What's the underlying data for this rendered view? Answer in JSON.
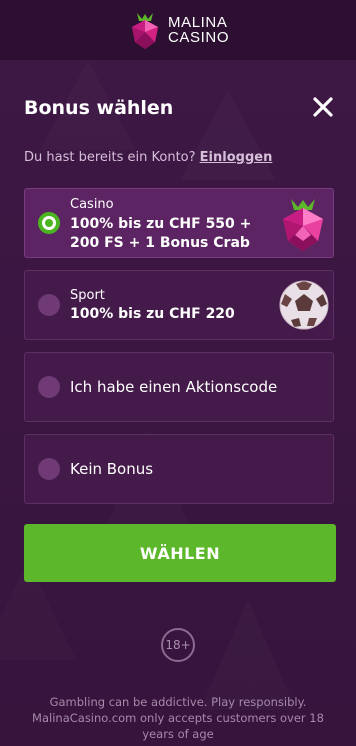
{
  "header": {
    "logo_line1": "MALINA",
    "logo_line2": "CASINO"
  },
  "modal": {
    "title": "Bonus wählen",
    "close_label": "×",
    "login_prompt": "Du hast bereits ein Konto?",
    "login_link": "Einloggen"
  },
  "options": [
    {
      "category": "Casino",
      "description": "100% bis zu CHF 550 + 200 FS + 1 Bonus Crab",
      "selected": true,
      "icon": "raspberry-gem-icon"
    },
    {
      "category": "Sport",
      "description": "100% bis zu CHF 220",
      "selected": false,
      "icon": "soccer-ball-icon"
    },
    {
      "label": "Ich habe einen Aktionscode",
      "selected": false
    },
    {
      "label": "Kein Bonus",
      "selected": false
    }
  ],
  "cta": {
    "label": "WÄHLEN"
  },
  "footer": {
    "age_badge": "18+",
    "disclaimer": "Gambling can be addictive. Play responsibly. MalinaCasino.com only accepts customers over 18 years of age"
  },
  "colors": {
    "background": "#3a1640",
    "header": "#2c0f31",
    "accent_green": "#5cb82a",
    "option_border": "#5e2f63",
    "selected_bg": "#5c2462"
  }
}
